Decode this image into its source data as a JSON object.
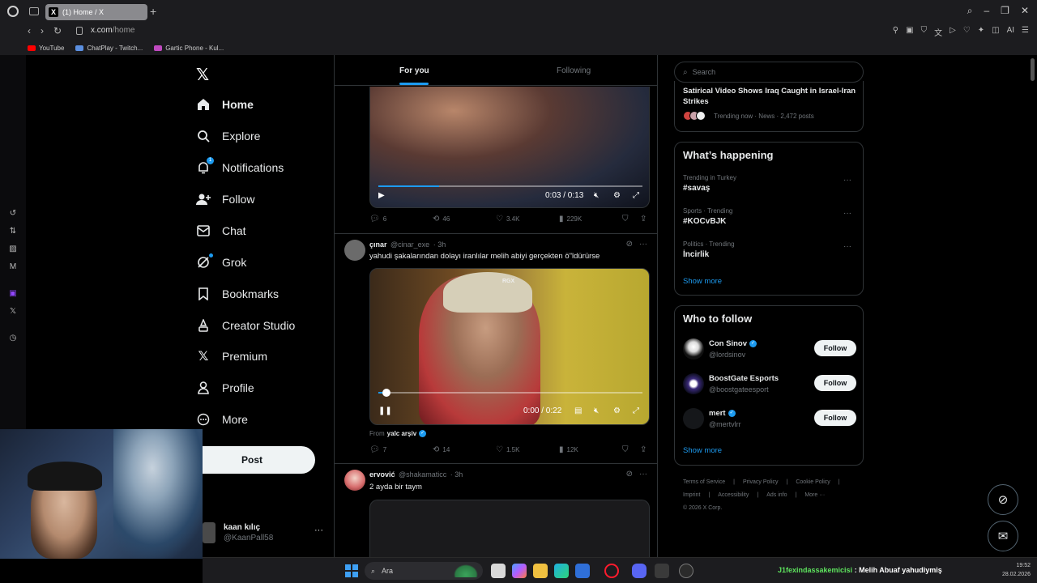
{
  "browser": {
    "tab_title": "(1) Home / X",
    "url_domain": "x.com",
    "url_path": "/home",
    "bookmarks": [
      {
        "label": "YouTube",
        "color": "#ff0000"
      },
      {
        "label": "ChatPlay - Twitch...",
        "color": "#5b8fe0"
      },
      {
        "label": "Gartic Phone - Kul...",
        "color": "#c04ac0"
      }
    ],
    "ai_label": "AI"
  },
  "nav": {
    "items": [
      {
        "label": "Home",
        "icon": "home-icon",
        "active": true
      },
      {
        "label": "Explore",
        "icon": "search-icon"
      },
      {
        "label": "Notifications",
        "icon": "bell-icon",
        "badge": "1"
      },
      {
        "label": "Follow",
        "icon": "person-add-icon"
      },
      {
        "label": "Chat",
        "icon": "mail-icon"
      },
      {
        "label": "Grok",
        "icon": "grok-icon",
        "dot": true
      },
      {
        "label": "Bookmarks",
        "icon": "bookmark-icon"
      },
      {
        "label": "Creator Studio",
        "icon": "creator-icon"
      },
      {
        "label": "Premium",
        "icon": "x-icon"
      },
      {
        "label": "Profile",
        "icon": "profile-icon"
      },
      {
        "label": "More",
        "icon": "more-circle-icon"
      }
    ],
    "post_label": "Post",
    "account": {
      "name": "kaan kılıç",
      "handle": "@KaanPall58",
      "more": "···"
    }
  },
  "feed": {
    "tabs": [
      "For you",
      "Following"
    ],
    "tweet1": {
      "video_time": "0:03 / 0:13",
      "progress": 0.23,
      "stats": {
        "replies": "6",
        "reposts": "46",
        "likes": "3.4K",
        "views": "229K"
      }
    },
    "tweet2": {
      "name": "çınar",
      "handle": "@cinar_exe",
      "time": "· 3h",
      "text": "yahudi şakalarından dolayı iranlılar melih abiyi gerçekten ö\"ldürürse",
      "watermark": "RGX",
      "video_time": "0:00 / 0:22",
      "progress": 0.03,
      "from_label": "From",
      "from_name": "yalc arşiv",
      "stats": {
        "replies": "7",
        "reposts": "14",
        "likes": "1.5K",
        "views": "12K"
      }
    },
    "tweet3": {
      "name": "ervović",
      "handle": "@shakamaticc",
      "time": "· 3h",
      "text": "2 ayda bir taym"
    }
  },
  "sidebar": {
    "search_placeholder": "Search",
    "top_trend": {
      "headline": "Satirical Video Shows Iraq Caught in Israel-Iran Strikes",
      "meta": "Trending now · News · 2,472 posts"
    },
    "whats_happening": {
      "title": "What’s happening",
      "trends": [
        {
          "context": "Trending in Turkey",
          "name": "#savaş"
        },
        {
          "context": "Sports · Trending",
          "name": "#KOCvBJK"
        },
        {
          "context": "Politics · Trending",
          "name": "İncirlik"
        }
      ],
      "show_more": "Show more"
    },
    "who_to_follow": {
      "title": "Who to follow",
      "users": [
        {
          "name": "Con Sinov",
          "handle": "@lordsinov",
          "verified": true
        },
        {
          "name": "BoostGate Esports",
          "handle": "@boostgateesport",
          "verified": false
        },
        {
          "name": "mert",
          "handle": "@mertvlrr",
          "verified": true
        }
      ],
      "follow_label": "Follow",
      "show_more": "Show more"
    },
    "footer": {
      "links1": [
        "Terms of Service",
        "|",
        "Privacy Policy",
        "|",
        "Cookie Policy",
        "|"
      ],
      "links2": [
        "Imprint",
        "|",
        "Accessibility",
        "|",
        "Ads info",
        "|",
        "More ···"
      ],
      "copyright": "© 2026 X Corp."
    }
  },
  "taskbar": {
    "search_label": "Ara",
    "chat_user": "J1fexindassakemicisi",
    "chat_message": ": Melih Abuaf yahudiymiş",
    "time": "19:52",
    "date": "28.02.2026"
  },
  "colors": {
    "accent": "#1d9bf0",
    "background": "#000000",
    "border": "#2f3336",
    "muted": "#71767b"
  }
}
